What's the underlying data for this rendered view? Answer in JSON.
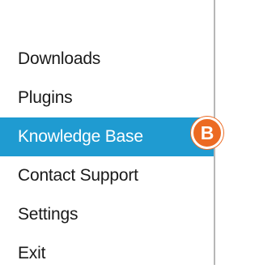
{
  "menu": {
    "items": [
      {
        "label": "Downloads"
      },
      {
        "label": "Plugins"
      },
      {
        "label": "Knowledge Base",
        "active": true
      },
      {
        "label": "Contact Support"
      },
      {
        "label": "Settings"
      },
      {
        "label": "Exit"
      }
    ]
  },
  "callout": {
    "label": "B",
    "color": "#ec6a22"
  },
  "colors": {
    "highlight": "#1f9bd1",
    "text": "#1a1a1a"
  }
}
